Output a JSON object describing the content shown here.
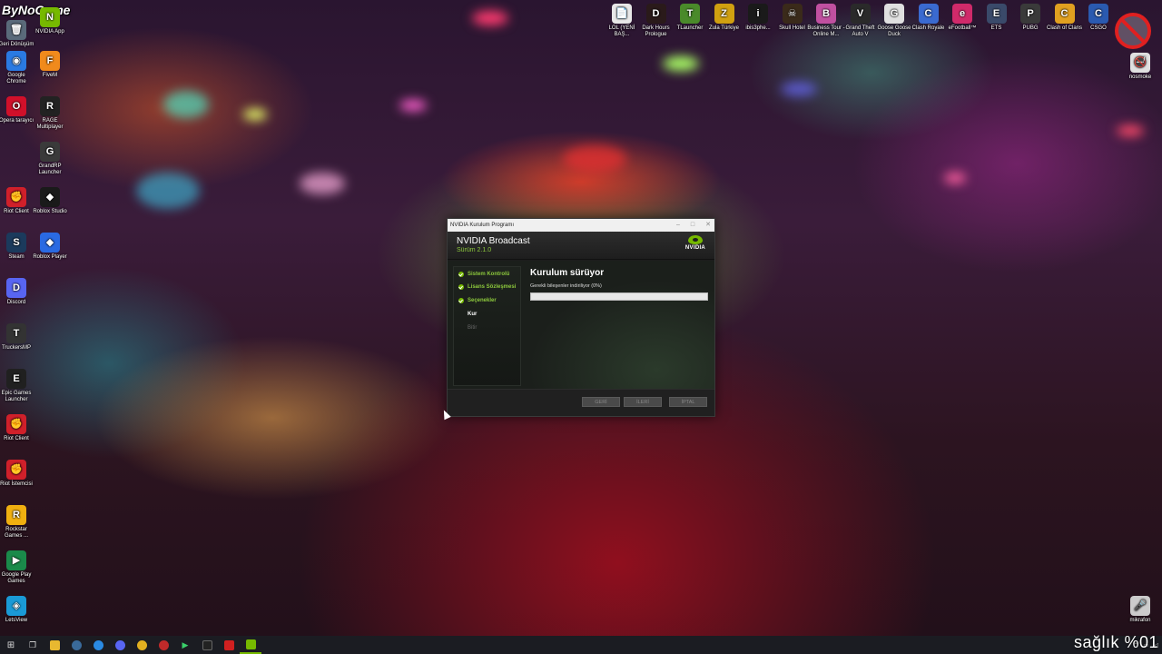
{
  "watermark": "ByNoGame",
  "desktop_left": [
    {
      "label": "Geri Dönüşüm",
      "color": "#5a6a7a",
      "glyph": "🗑"
    },
    {
      "label": "NVIDIA App",
      "color": "#76b900",
      "glyph": "N"
    },
    {
      "label": "Google Chrome",
      "color": "#2a7ae2",
      "glyph": "◉"
    },
    {
      "label": "FiveM",
      "color": "#f08a1c",
      "glyph": "F"
    },
    {
      "label": "Opera tarayıcı",
      "color": "#d0102a",
      "glyph": "O"
    },
    {
      "label": "RAGE Multiplayer",
      "color": "#222222",
      "glyph": "R"
    },
    {
      "label": "GrandRP Launcher",
      "color": "#3a3a3a",
      "glyph": "G"
    },
    {
      "label": "Riot Client",
      "color": "#d0202a",
      "glyph": "✊"
    },
    {
      "label": "Roblox Studio",
      "color": "#1a1a1a",
      "glyph": "◆"
    },
    {
      "label": "Steam",
      "color": "#1b3a5c",
      "glyph": "S"
    },
    {
      "label": "Roblox Player",
      "color": "#2a6ae2",
      "glyph": "◆"
    },
    {
      "label": "Discord",
      "color": "#5865f2",
      "glyph": "D"
    },
    {
      "label": "TruckersMP",
      "color": "#333333",
      "glyph": "T"
    },
    {
      "label": "Epic Games Launcher",
      "color": "#202020",
      "glyph": "E"
    },
    {
      "label": "Riot Client",
      "color": "#d0202a",
      "glyph": "✊"
    },
    {
      "label": "Riot İstemcisi",
      "color": "#d0202a",
      "glyph": "✊"
    },
    {
      "label": "Rockstar Games ...",
      "color": "#f0b010",
      "glyph": "R"
    },
    {
      "label": "Google Play Games",
      "color": "#1a8a4a",
      "glyph": "▶"
    },
    {
      "label": "LetsView",
      "color": "#1a9ad6",
      "glyph": "◈"
    }
  ],
  "desktop_top": [
    {
      "label": "LOL (YENİ BAŞ...",
      "color": "#e8e8e8",
      "glyph": "📄"
    },
    {
      "label": "Dark Hours Prologue",
      "color": "#2a1a1a",
      "glyph": "D"
    },
    {
      "label": "TLauncher",
      "color": "#4a8a2a",
      "glyph": "T"
    },
    {
      "label": "Zula Türkiye",
      "color": "#d0a010",
      "glyph": "Z"
    },
    {
      "label": "ibis3phe...",
      "color": "#1a1a1a",
      "glyph": "i"
    },
    {
      "label": "Skull Hotel",
      "color": "#3a2a1a",
      "glyph": "☠"
    },
    {
      "label": "Business Tour - Online M...",
      "color": "#c050a0",
      "glyph": "B"
    },
    {
      "label": "Grand Theft Auto V",
      "color": "#2a2a2a",
      "glyph": "V"
    },
    {
      "label": "Goose Goose Duck",
      "color": "#e0e0e0",
      "glyph": "G"
    },
    {
      "label": "Clash Royale",
      "color": "#3a6ad0",
      "glyph": "C"
    },
    {
      "label": "eFootball™",
      "color": "#d02a6a",
      "glyph": "e"
    },
    {
      "label": "ETS",
      "color": "#3a4a6a",
      "glyph": "E"
    },
    {
      "label": "PUBG",
      "color": "#3a3a3a",
      "glyph": "P"
    },
    {
      "label": "Clash of Clans",
      "color": "#e0a020",
      "glyph": "C"
    },
    {
      "label": "CSGO",
      "color": "#2a5ab0",
      "glyph": "C"
    }
  ],
  "desktop_right": [
    {
      "label": "nosmoke",
      "color": "#e0e0e0",
      "glyph": "🚭"
    },
    {
      "label": "mikrafon",
      "color": "#cccccc",
      "glyph": "🎤"
    }
  ],
  "installer": {
    "window_title": "NVIDIA Kurulum Programı",
    "min": "–",
    "max": "□",
    "close": "✕",
    "product": "NVIDIA Broadcast",
    "version": "Sürüm 2.1.0",
    "logo_text": "NVIDIA",
    "steps": [
      {
        "label": "Sistem Kontrolü",
        "state": "done"
      },
      {
        "label": "Lisans Sözleşmesi",
        "state": "done"
      },
      {
        "label": "Seçenekler",
        "state": "done"
      },
      {
        "label": "Kur",
        "state": "current"
      },
      {
        "label": "Bitir",
        "state": "todo"
      }
    ],
    "heading": "Kurulum sürüyor",
    "status": "Gerekli bileşenler indiriliyor (0%)",
    "progress": 0,
    "buttons": {
      "back": "GERİ",
      "next": "İLERİ",
      "cancel": "İPTAL"
    }
  },
  "overlay": "sağlık %01",
  "colors": {
    "accent": "#76b900"
  }
}
